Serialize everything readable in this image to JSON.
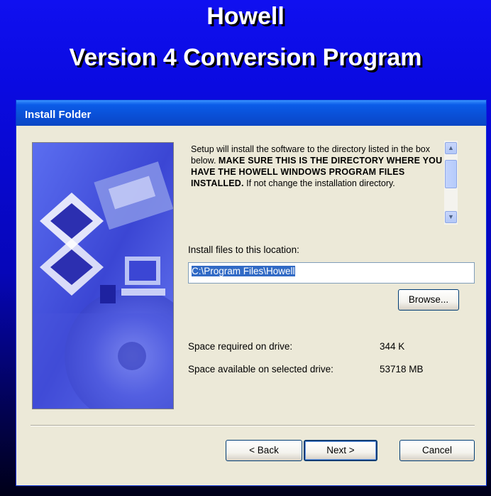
{
  "banner": {
    "title": "Howell",
    "subtitle": "Version 4 Conversion Program"
  },
  "dialog": {
    "title": "Install Folder",
    "info_text_1": "Setup will install the software to the directory listed in the box below. ",
    "info_text_bold": "MAKE SURE THIS IS THE DIRECTORY WHERE YOU HAVE THE HOWELL WINDOWS PROGRAM FILES INSTALLED.",
    "info_text_2": " If not change the installation directory.",
    "install_label": "Install files to this location:",
    "install_path": "C:\\Program Files\\Howell",
    "browse_label": "Browse...",
    "space_required_label": "Space required on drive:",
    "space_required_value": "344 K",
    "space_available_label": "Space available on selected drive:",
    "space_available_value": "53718 MB",
    "back_label": "< Back",
    "next_label": "Next >",
    "cancel_label": "Cancel"
  },
  "colors": {
    "background_top": "#1010f0",
    "titlebar": "#0a4fd6",
    "dialog_face": "#ece9d8"
  },
  "icons": {
    "scroll_up": "chevron-up-icon",
    "scroll_down": "chevron-down-icon"
  }
}
